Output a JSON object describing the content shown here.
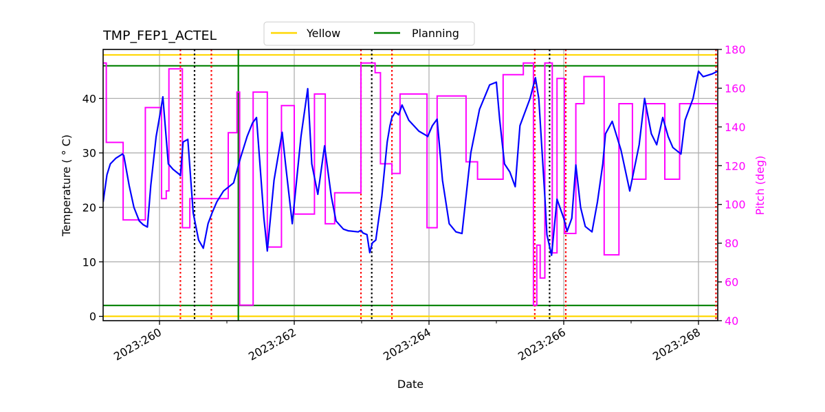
{
  "chart_data": {
    "type": "line",
    "title": "TMP_FEP1_ACTEL",
    "xlabel": "Date",
    "ylabel": "Temperature ($^\\circ$C)",
    "ylabel_display": "Temperature ( ° C)",
    "y2label": "Pitch (deg)",
    "xlim": [
      259.163,
      268.286
    ],
    "ylim": [
      -0.8,
      49
    ],
    "y2lim": [
      40,
      180
    ],
    "grid": true,
    "x_ticks": [
      {
        "value": 260,
        "label": "2023:260"
      },
      {
        "value": 262,
        "label": "2023:262"
      },
      {
        "value": 264,
        "label": "2023:264"
      },
      {
        "value": 266,
        "label": "2023:266"
      },
      {
        "value": 268,
        "label": "2023:268"
      }
    ],
    "x_minor_ticks": [
      261,
      263,
      265,
      267
    ],
    "y_ticks": [
      0,
      10,
      20,
      30,
      40
    ],
    "y2_ticks": [
      40,
      60,
      80,
      100,
      120,
      140,
      160,
      180
    ],
    "legend": {
      "placement": "top-center",
      "entries": [
        {
          "label": "Yellow",
          "color": "#ffd700"
        },
        {
          "label": "Planning",
          "color": "#008000"
        }
      ]
    },
    "colors": {
      "temperature": "#0000ff",
      "pitch": "#ff00ff",
      "yellow": "#ffd700",
      "planning": "#008000",
      "grid": "#b0b0b0",
      "red_event": "#ff0000",
      "black_event": "#000000"
    },
    "hlines": [
      {
        "name": "yellow-high",
        "y": 48,
        "color": "#ffd700"
      },
      {
        "name": "yellow-low",
        "y": 0,
        "color": "#ffd700"
      },
      {
        "name": "planning-high",
        "y": 46,
        "color": "#008000"
      },
      {
        "name": "planning-low",
        "y": 2,
        "color": "#008000"
      }
    ],
    "vlines": [
      {
        "x": 260.31,
        "color": "#ff0000",
        "style": "dotted"
      },
      {
        "x": 260.52,
        "color": "#000000",
        "style": "dotted"
      },
      {
        "x": 260.77,
        "color": "#ff0000",
        "style": "dotted"
      },
      {
        "x": 261.17,
        "color": "#008000",
        "style": "solid"
      },
      {
        "x": 262.99,
        "color": "#ff0000",
        "style": "dotted"
      },
      {
        "x": 263.15,
        "color": "#000000",
        "style": "dotted"
      },
      {
        "x": 263.45,
        "color": "#ff0000",
        "style": "dotted"
      },
      {
        "x": 265.57,
        "color": "#ff0000",
        "style": "dotted"
      },
      {
        "x": 265.79,
        "color": "#000000",
        "style": "dotted"
      },
      {
        "x": 266.03,
        "color": "#ff0000",
        "style": "dotted"
      },
      {
        "x": 268.26,
        "color": "#ff0000",
        "style": "dotted"
      }
    ],
    "series": [
      {
        "name": "Temperature",
        "axis": "left",
        "x": [
          259.163,
          259.22,
          259.27,
          259.35,
          259.45,
          259.47,
          259.55,
          259.62,
          259.7,
          259.76,
          259.82,
          259.87,
          259.95,
          260.02,
          260.05,
          260.13,
          260.2,
          260.3,
          260.31,
          260.35,
          260.42,
          260.5,
          260.58,
          260.65,
          260.72,
          260.78,
          260.85,
          260.95,
          261.05,
          261.1,
          261.2,
          261.3,
          261.38,
          261.44,
          261.55,
          261.6,
          261.7,
          261.82,
          261.87,
          261.97,
          262.1,
          262.2,
          262.26,
          262.35,
          262.45,
          262.55,
          262.62,
          262.73,
          262.8,
          262.95,
          262.99,
          263.02,
          263.08,
          263.12,
          263.16,
          263.21,
          263.3,
          263.38,
          263.42,
          263.45,
          263.5,
          263.55,
          263.6,
          263.7,
          263.85,
          263.96,
          263.98,
          264.05,
          264.12,
          264.2,
          264.3,
          264.4,
          264.49,
          264.62,
          264.75,
          264.9,
          265.0,
          265.05,
          265.12,
          265.2,
          265.28,
          265.35,
          265.5,
          265.58,
          265.63,
          265.72,
          265.75,
          265.82,
          265.9,
          266.0,
          266.05,
          266.12,
          266.18,
          266.25,
          266.32,
          266.42,
          266.5,
          266.58,
          266.62,
          266.72,
          266.85,
          266.98,
          267.12,
          267.2,
          267.3,
          267.38,
          267.47,
          267.55,
          267.62,
          267.74,
          267.8,
          267.92,
          268.0,
          268.07,
          268.2,
          268.286
        ],
        "y": [
          21,
          26,
          28,
          29,
          29.8,
          29.5,
          24,
          20,
          17.5,
          16.8,
          16.4,
          24,
          33,
          38,
          40.3,
          28,
          27,
          26,
          25.8,
          32,
          32.5,
          19,
          14,
          12.5,
          17,
          19,
          21,
          23,
          24,
          24.5,
          29,
          33,
          35.5,
          36.5,
          18,
          12,
          25,
          33.8,
          28,
          17,
          33,
          41.8,
          28,
          22.4,
          31.3,
          22,
          17.5,
          16,
          15.7,
          15.5,
          15.8,
          15.3,
          15,
          11.7,
          13.5,
          14,
          22,
          32,
          35,
          36.5,
          37.5,
          37,
          38.8,
          36,
          34,
          33.2,
          33,
          35,
          36.2,
          25,
          17,
          15.5,
          15.2,
          30,
          38,
          42.5,
          43,
          36,
          28,
          26.5,
          23.8,
          35,
          40,
          43.8,
          40,
          22,
          15,
          11.2,
          21.5,
          18,
          15.6,
          18,
          27.8,
          20,
          16.5,
          15.5,
          21,
          28,
          33.5,
          35.8,
          30.5,
          23,
          31.5,
          40,
          33.5,
          31.5,
          36.5,
          33,
          31,
          29.8,
          36,
          40,
          45,
          44,
          44.5,
          45
        ]
      },
      {
        "name": "Pitch",
        "axis": "right",
        "step": true,
        "x": [
          259.163,
          259.21,
          259.21,
          259.46,
          259.46,
          259.79,
          259.79,
          260.03,
          260.03,
          260.1,
          260.1,
          260.14,
          260.14,
          260.34,
          260.34,
          260.45,
          260.45,
          260.76,
          260.76,
          261.02,
          261.02,
          261.15,
          261.15,
          261.19,
          261.19,
          261.39,
          261.39,
          261.6,
          261.6,
          261.81,
          261.81,
          262.0,
          262.0,
          262.3,
          262.3,
          262.46,
          262.46,
          262.6,
          262.6,
          262.99,
          262.99,
          263.2,
          263.2,
          263.28,
          263.28,
          263.45,
          263.45,
          263.57,
          263.57,
          263.97,
          263.97,
          264.12,
          264.12,
          264.55,
          264.55,
          264.72,
          264.72,
          265.1,
          265.1,
          265.4,
          265.4,
          265.55,
          265.55,
          265.6,
          265.6,
          265.65,
          265.65,
          265.72,
          265.72,
          265.83,
          265.83,
          265.9,
          265.9,
          266.01,
          266.01,
          266.18,
          266.18,
          266.3,
          266.3,
          266.6,
          266.6,
          266.82,
          266.82,
          267.02,
          267.02,
          267.22,
          267.22,
          267.5,
          267.5,
          267.72,
          267.72,
          267.96,
          267.96,
          268.2,
          268.2,
          268.286
        ],
        "y": [
          173,
          173,
          132,
          132,
          92,
          92,
          150,
          150,
          103,
          103,
          107,
          107,
          170,
          170,
          88,
          88,
          103,
          103,
          103,
          103,
          137,
          137,
          158,
          158,
          48,
          48,
          158,
          158,
          78,
          78,
          151,
          151,
          95,
          95,
          157,
          157,
          90,
          90,
          106,
          106,
          173,
          173,
          168,
          168,
          121,
          121,
          116,
          116,
          157,
          157,
          88,
          88,
          156,
          156,
          122,
          122,
          113,
          113,
          167,
          167,
          173,
          173,
          48,
          48,
          79,
          79,
          62,
          62,
          173,
          173,
          75,
          75,
          165,
          165,
          85,
          85,
          152,
          152,
          166,
          166,
          74,
          74,
          152,
          152,
          113,
          113,
          152,
          152,
          113,
          113,
          152,
          152,
          152,
          152,
          152,
          152
        ]
      }
    ]
  }
}
